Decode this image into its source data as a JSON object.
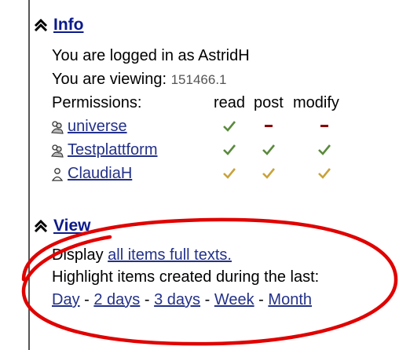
{
  "info": {
    "title": "Info",
    "logged_in_text": "You are logged in as AstridH",
    "viewing_label": "You are viewing:",
    "viewing_value": "151466.1",
    "permissions_label": "Permissions:",
    "perm_headers": [
      "read",
      "post",
      "modify"
    ],
    "perm_rows": [
      {
        "name": "universe",
        "icon": "group-icon",
        "read": "check-green",
        "post": "dash-red",
        "modify": "dash-red"
      },
      {
        "name": "Testplattform",
        "icon": "group-icon",
        "read": "check-green",
        "post": "check-green",
        "modify": "check-green"
      },
      {
        "name": "ClaudiaH",
        "icon": "user-icon",
        "read": "check-yellow",
        "post": "check-yellow",
        "modify": "check-yellow"
      }
    ]
  },
  "view": {
    "title": "View",
    "display_label": "Display",
    "display_link": "all items full texts.",
    "highlight_label": "Highlight items created during the last:",
    "periods": [
      "Day",
      "2 days",
      "3 days",
      "Week",
      "Month"
    ],
    "separator": "-"
  },
  "colors": {
    "link": "#23318a",
    "check_green": "#5a8a3c",
    "check_yellow": "#c9a23a",
    "dash_red": "#8b0000",
    "annotation": "#e00000"
  }
}
